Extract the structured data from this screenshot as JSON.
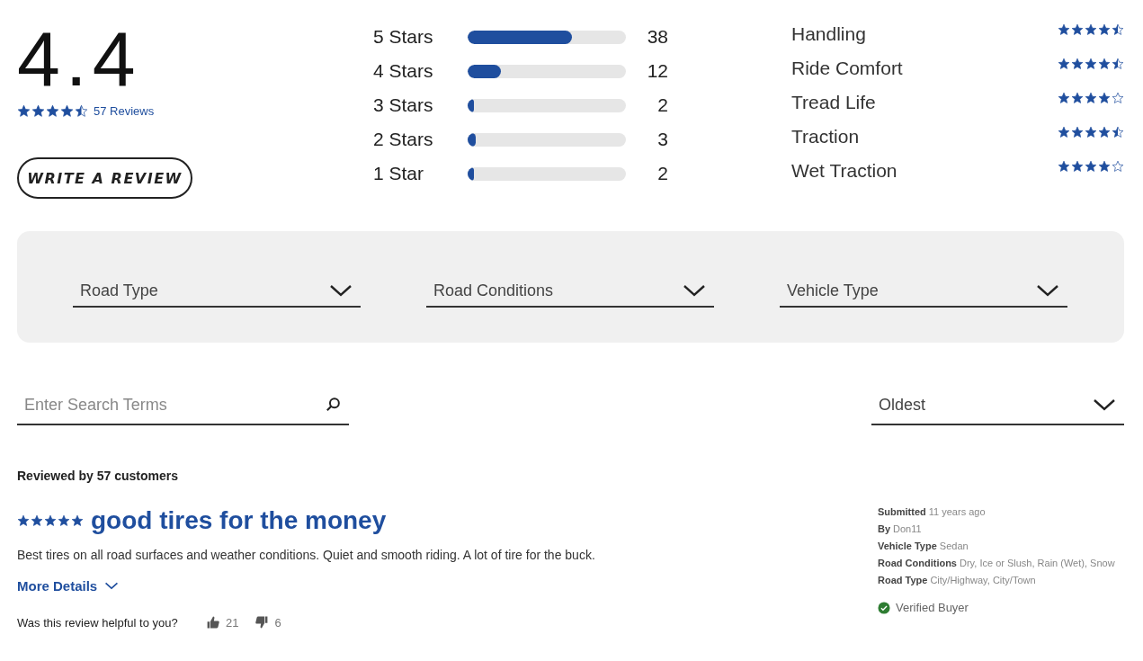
{
  "summary": {
    "average": "4.4",
    "stars": 4.5,
    "reviews_link": "57 Reviews",
    "write_button": "WRITE A REVIEW"
  },
  "histogram": [
    {
      "label": "5 Stars",
      "level": 0.66,
      "count": "38"
    },
    {
      "label": "4 Stars",
      "level": 0.21,
      "count": "12"
    },
    {
      "label": "3 Stars",
      "level": 0.04,
      "count": "2"
    },
    {
      "label": "2 Stars",
      "level": 0.05,
      "count": "3"
    },
    {
      "label": "1 Star",
      "level": 0.04,
      "count": "2"
    }
  ],
  "attributes": [
    {
      "label": "Handling",
      "stars": 4.5
    },
    {
      "label": "Ride Comfort",
      "stars": 4.5
    },
    {
      "label": "Tread Life",
      "stars": 4
    },
    {
      "label": "Traction",
      "stars": 4.5
    },
    {
      "label": "Wet Traction",
      "stars": 4
    }
  ],
  "filters": [
    {
      "placeholder": "Road Type"
    },
    {
      "placeholder": "Road Conditions"
    },
    {
      "placeholder": "Vehicle Type"
    }
  ],
  "search": {
    "placeholder": "Enter Search Terms"
  },
  "sort": {
    "value": "Oldest"
  },
  "reviewed_by": "Reviewed by 57 customers",
  "review": {
    "stars": 5,
    "title": "good tires for the money",
    "body": "Best tires on all road surfaces and weather conditions. Quiet and smooth riding. A lot of tire for the buck.",
    "more_details": "More Details",
    "helpful_question": "Was this review helpful to you?",
    "up_votes": "21",
    "down_votes": "6",
    "details": [
      {
        "label": "Submitted",
        "value": "11 years ago"
      },
      {
        "label": "By",
        "value": "Don11"
      },
      {
        "label": "Vehicle Type",
        "value": "Sedan"
      },
      {
        "label": "Road Conditions",
        "value": "Dry, Ice or Slush, Rain (Wet), Snow"
      },
      {
        "label": "Road Type",
        "value": "City/Highway, City/Town"
      }
    ],
    "verified": "Verified Buyer"
  }
}
